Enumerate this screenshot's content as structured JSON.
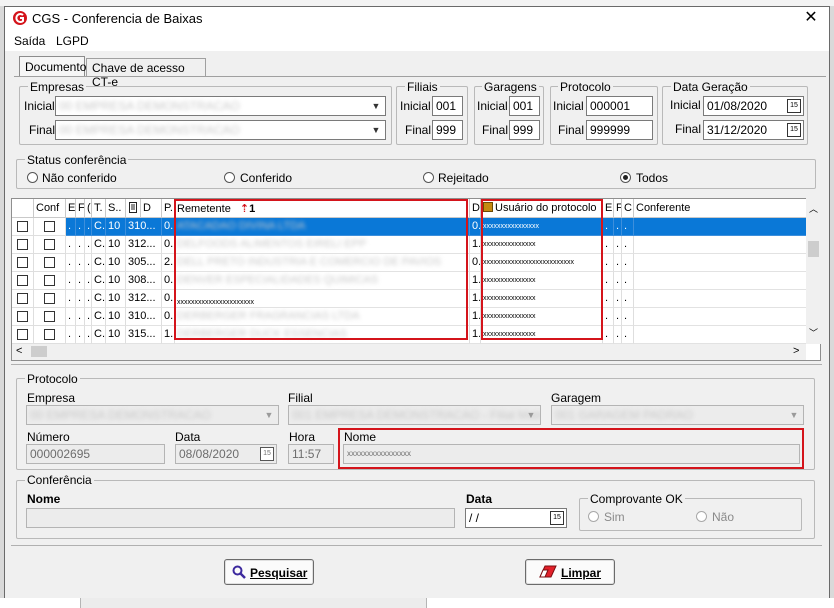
{
  "window": {
    "title": "CGS - Conferencia de Baixas",
    "close_glyph": "✕"
  },
  "menu": {
    "items": [
      "Saída",
      "LGPD"
    ]
  },
  "tabs": [
    "Documento",
    "Chave de acesso CT-e"
  ],
  "filters": {
    "empresas": {
      "label": "Empresas",
      "inicial_label": "Inicial",
      "final_label": "Final",
      "inicial_value": "00 EMPRESA DEMONSTRACAO",
      "final_value": "00 EMPRESA DEMONSTRACAO"
    },
    "filiais": {
      "label": "Filiais",
      "inicial_label": "Inicial",
      "final_label": "Final",
      "inicial": "001",
      "final": "999"
    },
    "garagens": {
      "label": "Garagens",
      "inicial_label": "Inicial",
      "final_label": "Final",
      "inicial": "001",
      "final": "999"
    },
    "protocolo": {
      "label": "Protocolo",
      "inicial_label": "Inicial",
      "final_label": "Final",
      "inicial": "000001",
      "final": "999999"
    },
    "data_geracao": {
      "label": "Data Geração",
      "inicial_label": "Inicial",
      "final_label": "Final",
      "inicial": "01/08/2020",
      "final": "31/12/2020"
    }
  },
  "status": {
    "label": "Status conferência",
    "options": [
      "Não conferido",
      "Conferido",
      "Rejeitado",
      "Todos"
    ],
    "selected": "Todos"
  },
  "grid": {
    "headers": [
      "Conf",
      "E",
      "F",
      "(",
      "T.",
      "S..",
      "",
      "D",
      "P.",
      "Remetente",
      "D",
      "Usuário do protocolo",
      "E",
      "F",
      "C",
      "Conferente"
    ],
    "sort_indicator": "1",
    "rows": [
      {
        "t": "C.",
        "s": "10",
        "n": "310...",
        "d": "0...",
        "remetente": "ATACADAO DIVINA LTDA",
        "dd": "0.",
        "usuario": "xxxxxxxxxxxxxxxx",
        "blurred": true
      },
      {
        "t": "C.",
        "s": "10",
        "n": "312...",
        "d": "0...",
        "remetente": "DELFOODS ALIMENTOS EIRELI EPP",
        "dd": "1.",
        "usuario": "xxxxxxxxxxxxxxx",
        "blurred": true
      },
      {
        "t": "C.",
        "s": "10",
        "n": "305...",
        "d": "2...",
        "remetente": "DELL PRETO INDUSTRIA E COMERCIO DE PAVIOS",
        "dd": "0.",
        "usuario": "xxxxxxxxxxxxxxxxxxxxxxxxxx",
        "blurred": true
      },
      {
        "t": "C.",
        "s": "10",
        "n": "308...",
        "d": "0...",
        "remetente": "DENVER ESPECIALIDADES QUIMICAS",
        "dd": "1.",
        "usuario": "xxxxxxxxxxxxxxx",
        "blurred": true
      },
      {
        "t": "C.",
        "s": "10",
        "n": "312...",
        "d": "0...",
        "remetente": "xxxxxxxxxxxxxxxxxxxxxx",
        "dd": "1.",
        "usuario": "xxxxxxxxxxxxxxx",
        "blurred": false
      },
      {
        "t": "C.",
        "s": "10",
        "n": "310...",
        "d": "0...",
        "remetente": "DERBERGER FRAGRANCIAS LTDA",
        "dd": "1.",
        "usuario": "xxxxxxxxxxxxxxx",
        "blurred": true
      },
      {
        "t": "C.",
        "s": "10",
        "n": "315...",
        "d": "1...",
        "remetente": "DERBERGER DUCK ESSENCIAS",
        "dd": "1.",
        "usuario": "xxxxxxxxxxxxxxx",
        "blurred": true
      }
    ]
  },
  "protocolo_panel": {
    "label": "Protocolo",
    "empresa_label": "Empresa",
    "empresa_value": "00 EMPRESA DEMONSTRACAO",
    "filial_label": "Filial",
    "filial_value": "001 EMPRESA DEMONSTRACAO - Filial Matriz",
    "garagem_label": "Garagem",
    "garagem_value": "001 GARAGEM PADRAO",
    "numero_label": "Número",
    "numero_value": "000002695",
    "data_label": "Data",
    "data_value": "08/08/2020",
    "hora_label": "Hora",
    "hora_value": "11:57",
    "nome_label": "Nome",
    "nome_value": "xxxxxxxxxxxxxxxx"
  },
  "conferencia_panel": {
    "label": "Conferência",
    "nome_label": "Nome",
    "nome_value": "",
    "data_label": "Data",
    "data_value": " /  /",
    "comprovante_label": "Comprovante OK",
    "sim_label": "Sim",
    "nao_label": "Não"
  },
  "buttons": {
    "pesquisar": "Pesquisar",
    "limpar": "Limpar"
  },
  "colors": {
    "accent_red": "#d4141b",
    "selection_blue": "#0a78d7"
  }
}
